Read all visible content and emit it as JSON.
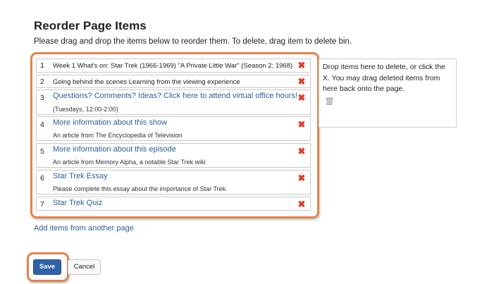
{
  "page": {
    "title": "Reorder Page Items",
    "instructions": "Please drag and drop the items below to reorder them. To delete, drag item to delete bin."
  },
  "items": [
    {
      "num": "1",
      "text": "Week 1 What's on: Star Trek (1966-1969) \"A Private Little War\" (Season 2; 1968)",
      "type": "text"
    },
    {
      "num": "2",
      "text": "Going behind the scenes Learning from the viewing experience",
      "type": "text"
    },
    {
      "num": "3",
      "link": "Questions? Comments? Ideas? Click here to attend virtual office hours!",
      "sub": "(Tuesdays, 12:00-2:00)",
      "type": "link"
    },
    {
      "num": "4",
      "link": "More information about this show",
      "sub": "An article from The Encyclopedia of Television",
      "type": "link"
    },
    {
      "num": "5",
      "link": "More information about this episode",
      "sub": "An article from Memory Alpha, a notable Star Trek wiki",
      "type": "link"
    },
    {
      "num": "6",
      "link": "Star Trek Essay",
      "sub": "Please complete this essay about the importance of Star Trek.",
      "type": "link"
    },
    {
      "num": "7",
      "link": "Star Trek Quiz",
      "type": "link"
    }
  ],
  "delete_bin": {
    "text": "Drop items here to delete, or click the X. You may drag deleted items from here back onto the page.",
    "icon": "trash-bin-icon"
  },
  "add_items_link": "Add items from another page",
  "buttons": {
    "save": "Save",
    "cancel": "Cancel"
  },
  "colors": {
    "accent_frame": "#e0844a",
    "link": "#2a5d9a",
    "delete_x": "#d93a2b",
    "save_button": "#2f62a8"
  },
  "icons": {
    "delete": "close-x-icon"
  }
}
